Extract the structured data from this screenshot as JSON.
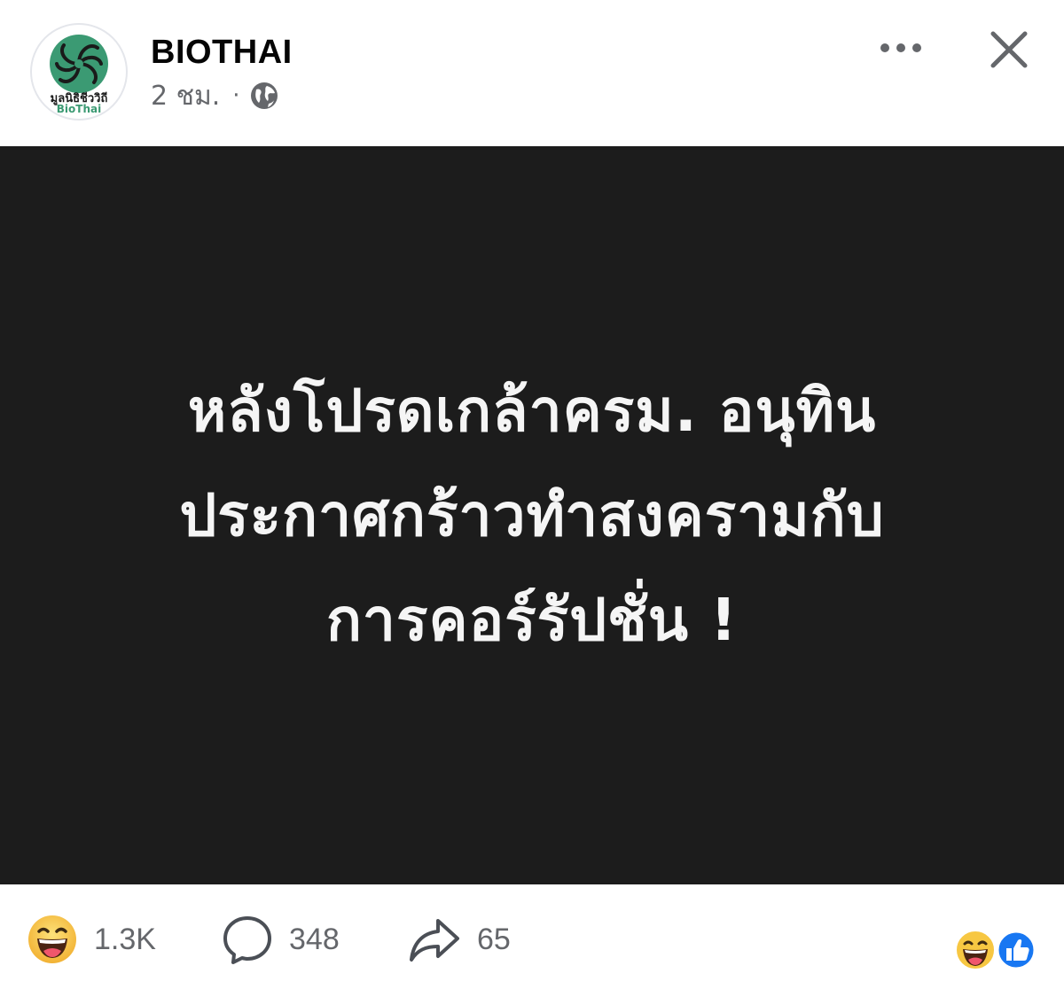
{
  "post": {
    "page_name": "BIOTHAI",
    "time": "2 ชม.",
    "separator": "·",
    "privacy_icon": "globe-icon",
    "logo": {
      "thai_text": "มูลนิธิชีววิถี",
      "latin_text": "BioThai",
      "color": "#3b9a73"
    },
    "image_text": [
      "หลังโปรดเกล้าครม. อนุทิน",
      "ประกาศกร้าวทำสงครามกับ",
      "การคอร์รัปชั่น !"
    ],
    "image_background": "#1c1c1c"
  },
  "actions": {
    "more_icon": "more-horizontal-icon",
    "close_icon": "close-icon"
  },
  "stats": {
    "reactions": "1.3K",
    "reactions_icon": "haha-emoji-icon",
    "comments": "348",
    "comments_icon": "comment-bubble-icon",
    "shares": "65",
    "shares_icon": "share-arrow-icon"
  },
  "reaction_summary": [
    "haha-emoji-icon",
    "like-icon"
  ],
  "colors": {
    "like_blue": "#1877f2",
    "emoji_yellow": "#f7c742",
    "secondary_text": "#65676b"
  }
}
